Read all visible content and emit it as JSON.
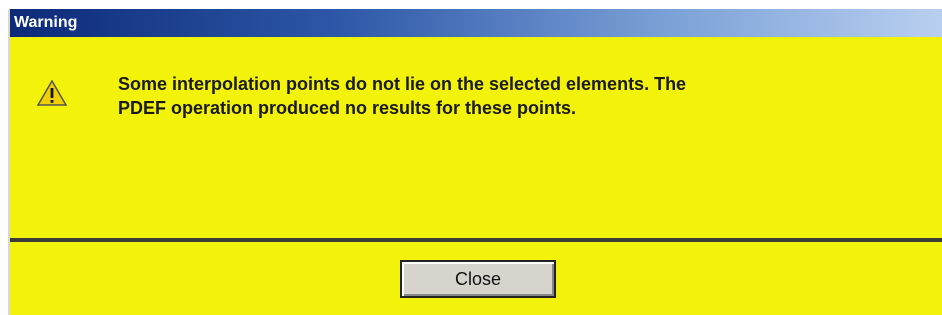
{
  "window": {
    "title": "Warning"
  },
  "icon": {
    "name": "warning-icon",
    "color": "#f0d000"
  },
  "message": {
    "line1": "Some interpolation points do not lie on the selected elements.  The",
    "line2": "PDEF operation produced no results for these points."
  },
  "buttons": {
    "close_label": "Close"
  },
  "colors": {
    "background": "#f2f20a",
    "title_bar_start": "#0c2a78",
    "title_bar_end": "#b9cff0"
  }
}
